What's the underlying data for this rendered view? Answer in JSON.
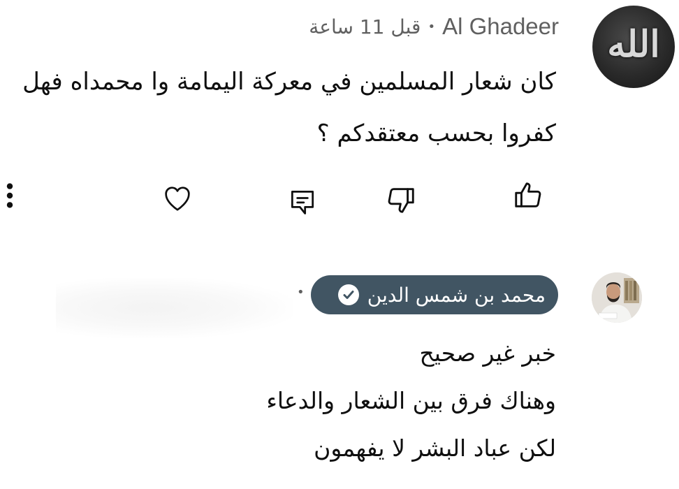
{
  "comment": {
    "author": "Al Ghadeer",
    "time": "قبل 11 ساعة",
    "avatar_text": "الله",
    "body_lines": [
      "كان شعار المسلمين في معركة اليمامة وا محمداه فهل",
      "كفروا  بحسب معتقدكم ؟"
    ],
    "actions": {
      "like_icon": "thumb-up-icon",
      "dislike_icon": "thumb-down-icon",
      "reply_icon": "reply-comment-icon",
      "heart_icon": "heart-icon",
      "more_icon": "more-vertical-icon"
    }
  },
  "reply": {
    "author": "محمد بن شمس الدين",
    "verified_icon": "check-circle-icon",
    "body_lines": [
      "خبر غير صحيح",
      "وهناك فرق بين الشعار والدعاء",
      "لكن عباد البشر لا يفهمون"
    ]
  },
  "colors": {
    "text": "#0f0f0f",
    "meta": "#606060",
    "badge_bg": "#415563",
    "badge_text": "#ffffff",
    "background": "#ffffff"
  }
}
